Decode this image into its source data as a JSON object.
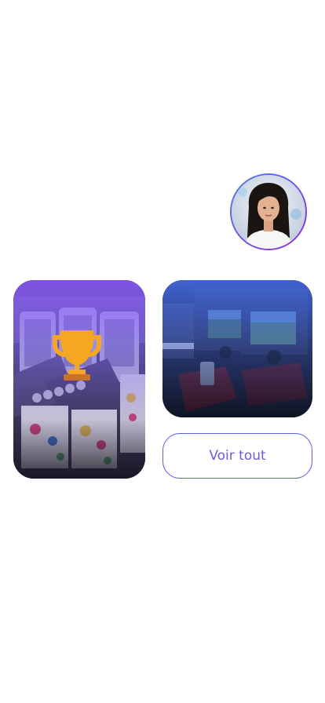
{
  "profile": {
    "avatar_icon": "person-avatar-icon",
    "ring_colors": [
      "#4f7cf0",
      "#8f2bd6"
    ]
  },
  "cards": [
    {
      "id": "basketball-arcade",
      "icon": "trophy-icon",
      "overlay_color": "#8c5aff"
    },
    {
      "id": "racing-arcade",
      "overlay_color": "#466eeb"
    }
  ],
  "actions": {
    "see_all_label": "Voir tout"
  },
  "colors": {
    "accent": "#5a5de0",
    "trophy": "#f5a623"
  }
}
